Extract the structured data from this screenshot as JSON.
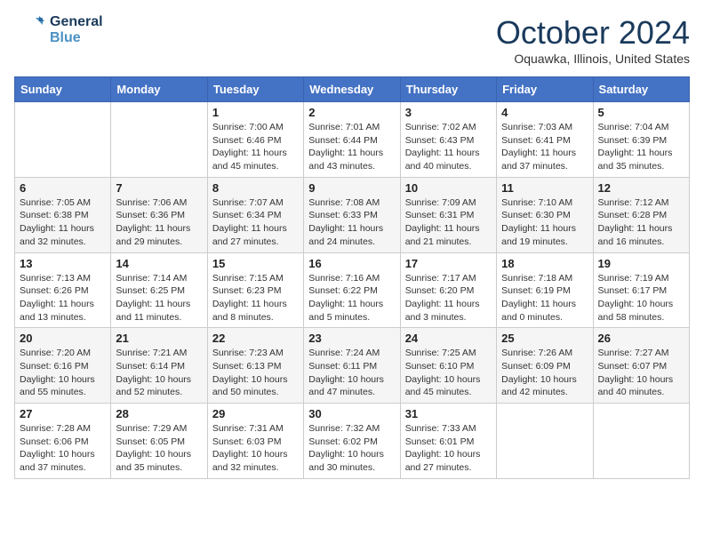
{
  "logo": {
    "line1": "General",
    "line2": "Blue"
  },
  "title": "October 2024",
  "location": "Oquawka, Illinois, United States",
  "weekdays": [
    "Sunday",
    "Monday",
    "Tuesday",
    "Wednesday",
    "Thursday",
    "Friday",
    "Saturday"
  ],
  "weeks": [
    [
      {
        "day": "",
        "detail": ""
      },
      {
        "day": "",
        "detail": ""
      },
      {
        "day": "1",
        "detail": "Sunrise: 7:00 AM\nSunset: 6:46 PM\nDaylight: 11 hours and 45 minutes."
      },
      {
        "day": "2",
        "detail": "Sunrise: 7:01 AM\nSunset: 6:44 PM\nDaylight: 11 hours and 43 minutes."
      },
      {
        "day": "3",
        "detail": "Sunrise: 7:02 AM\nSunset: 6:43 PM\nDaylight: 11 hours and 40 minutes."
      },
      {
        "day": "4",
        "detail": "Sunrise: 7:03 AM\nSunset: 6:41 PM\nDaylight: 11 hours and 37 minutes."
      },
      {
        "day": "5",
        "detail": "Sunrise: 7:04 AM\nSunset: 6:39 PM\nDaylight: 11 hours and 35 minutes."
      }
    ],
    [
      {
        "day": "6",
        "detail": "Sunrise: 7:05 AM\nSunset: 6:38 PM\nDaylight: 11 hours and 32 minutes."
      },
      {
        "day": "7",
        "detail": "Sunrise: 7:06 AM\nSunset: 6:36 PM\nDaylight: 11 hours and 29 minutes."
      },
      {
        "day": "8",
        "detail": "Sunrise: 7:07 AM\nSunset: 6:34 PM\nDaylight: 11 hours and 27 minutes."
      },
      {
        "day": "9",
        "detail": "Sunrise: 7:08 AM\nSunset: 6:33 PM\nDaylight: 11 hours and 24 minutes."
      },
      {
        "day": "10",
        "detail": "Sunrise: 7:09 AM\nSunset: 6:31 PM\nDaylight: 11 hours and 21 minutes."
      },
      {
        "day": "11",
        "detail": "Sunrise: 7:10 AM\nSunset: 6:30 PM\nDaylight: 11 hours and 19 minutes."
      },
      {
        "day": "12",
        "detail": "Sunrise: 7:12 AM\nSunset: 6:28 PM\nDaylight: 11 hours and 16 minutes."
      }
    ],
    [
      {
        "day": "13",
        "detail": "Sunrise: 7:13 AM\nSunset: 6:26 PM\nDaylight: 11 hours and 13 minutes."
      },
      {
        "day": "14",
        "detail": "Sunrise: 7:14 AM\nSunset: 6:25 PM\nDaylight: 11 hours and 11 minutes."
      },
      {
        "day": "15",
        "detail": "Sunrise: 7:15 AM\nSunset: 6:23 PM\nDaylight: 11 hours and 8 minutes."
      },
      {
        "day": "16",
        "detail": "Sunrise: 7:16 AM\nSunset: 6:22 PM\nDaylight: 11 hours and 5 minutes."
      },
      {
        "day": "17",
        "detail": "Sunrise: 7:17 AM\nSunset: 6:20 PM\nDaylight: 11 hours and 3 minutes."
      },
      {
        "day": "18",
        "detail": "Sunrise: 7:18 AM\nSunset: 6:19 PM\nDaylight: 11 hours and 0 minutes."
      },
      {
        "day": "19",
        "detail": "Sunrise: 7:19 AM\nSunset: 6:17 PM\nDaylight: 10 hours and 58 minutes."
      }
    ],
    [
      {
        "day": "20",
        "detail": "Sunrise: 7:20 AM\nSunset: 6:16 PM\nDaylight: 10 hours and 55 minutes."
      },
      {
        "day": "21",
        "detail": "Sunrise: 7:21 AM\nSunset: 6:14 PM\nDaylight: 10 hours and 52 minutes."
      },
      {
        "day": "22",
        "detail": "Sunrise: 7:23 AM\nSunset: 6:13 PM\nDaylight: 10 hours and 50 minutes."
      },
      {
        "day": "23",
        "detail": "Sunrise: 7:24 AM\nSunset: 6:11 PM\nDaylight: 10 hours and 47 minutes."
      },
      {
        "day": "24",
        "detail": "Sunrise: 7:25 AM\nSunset: 6:10 PM\nDaylight: 10 hours and 45 minutes."
      },
      {
        "day": "25",
        "detail": "Sunrise: 7:26 AM\nSunset: 6:09 PM\nDaylight: 10 hours and 42 minutes."
      },
      {
        "day": "26",
        "detail": "Sunrise: 7:27 AM\nSunset: 6:07 PM\nDaylight: 10 hours and 40 minutes."
      }
    ],
    [
      {
        "day": "27",
        "detail": "Sunrise: 7:28 AM\nSunset: 6:06 PM\nDaylight: 10 hours and 37 minutes."
      },
      {
        "day": "28",
        "detail": "Sunrise: 7:29 AM\nSunset: 6:05 PM\nDaylight: 10 hours and 35 minutes."
      },
      {
        "day": "29",
        "detail": "Sunrise: 7:31 AM\nSunset: 6:03 PM\nDaylight: 10 hours and 32 minutes."
      },
      {
        "day": "30",
        "detail": "Sunrise: 7:32 AM\nSunset: 6:02 PM\nDaylight: 10 hours and 30 minutes."
      },
      {
        "day": "31",
        "detail": "Sunrise: 7:33 AM\nSunset: 6:01 PM\nDaylight: 10 hours and 27 minutes."
      },
      {
        "day": "",
        "detail": ""
      },
      {
        "day": "",
        "detail": ""
      }
    ]
  ]
}
